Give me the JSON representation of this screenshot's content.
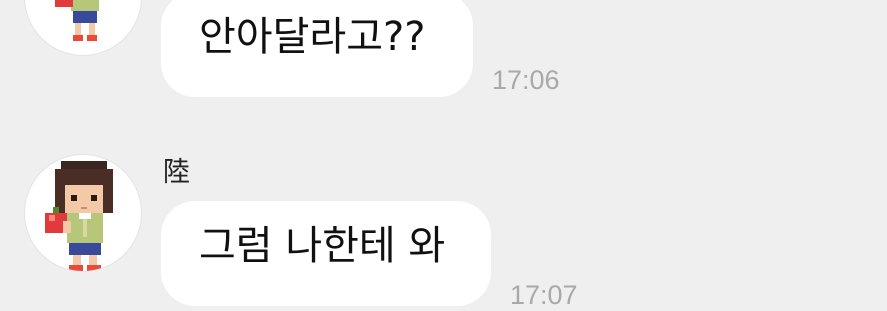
{
  "messages": [
    {
      "sender": "",
      "text": "안아달라고??",
      "time": "17:06"
    },
    {
      "sender": "陸",
      "text": "그럼 나한테 와",
      "time": "17:07"
    }
  ],
  "colors": {
    "background": "#efefef",
    "bubble": "#ffffff",
    "time_text": "#a9a9a9",
    "message_text": "#111111"
  },
  "icons": {
    "avatar": "pixel-character-holding-apple-avatar"
  }
}
